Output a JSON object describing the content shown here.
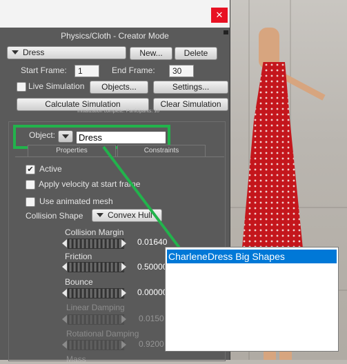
{
  "window": {
    "close_glyph": "✕",
    "panel_title": "Physics/Cloth - Creator Mode"
  },
  "creator": {
    "object_select": "Dress",
    "new_label": "New...",
    "delete_label": "Delete",
    "start_frame_label": "Start Frame:",
    "start_frame_value": "1",
    "end_frame_label": "End Frame:",
    "end_frame_value": "30",
    "live_sim_label": "Live Simulation",
    "objects_label": "Objects...",
    "settings_label": "Settings...",
    "calculate_label": "Calculate Simulation",
    "clear_label": "Clear Simulation",
    "status_text": "Initialization complete. Participants: 10"
  },
  "object_panel": {
    "object_label": "Object:",
    "object_value": "Dress",
    "tab_properties": "Properties",
    "tab_constraints": "Constraints",
    "active_label": "Active",
    "velocity_label": "Apply velocity at start frame",
    "animated_mesh_label": "Use animated mesh",
    "collision_shape_label": "Collision Shape",
    "collision_shape_value": "Convex Hull"
  },
  "params": [
    {
      "label": "Collision Margin",
      "value": "0.01640",
      "enabled": true
    },
    {
      "label": "Friction",
      "value": "0.50000",
      "enabled": true
    },
    {
      "label": "Bounce",
      "value": "0.00000",
      "enabled": true
    },
    {
      "label": "Linear Damping",
      "value": "0.0150",
      "enabled": false
    },
    {
      "label": "Rotational Damping",
      "value": "0.9200",
      "enabled": false
    },
    {
      "label": "Mass",
      "value": "",
      "enabled": false
    }
  ],
  "popup": {
    "items": [
      "CharleneDress Big Shapes"
    ]
  },
  "colors": {
    "highlight": "#22b34c",
    "selection": "#0078d7",
    "close": "#e81123"
  }
}
